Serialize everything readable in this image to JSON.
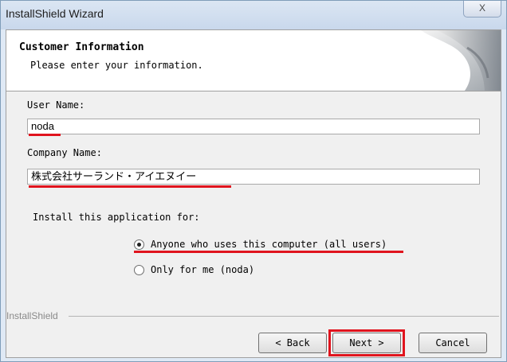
{
  "window": {
    "title": "InstallShield Wizard",
    "close_glyph": "X"
  },
  "header": {
    "title": "Customer Information",
    "subtitle": "Please enter your information."
  },
  "form": {
    "user_name_label": "User Name:",
    "user_name_value": "noda",
    "company_name_label": "Company Name:",
    "company_name_value": "株式会社サーランド・アイエヌイー",
    "install_for_label": "Install this application for:",
    "options": [
      {
        "label": "Anyone who uses this computer (all users)",
        "selected": true
      },
      {
        "label": "Only for me (noda)",
        "selected": false
      }
    ]
  },
  "footer": {
    "brand": "InstallShield",
    "back_label": "< Back",
    "next_label": "Next >",
    "cancel_label": "Cancel"
  },
  "colors": {
    "annotation_red": "#e0141e",
    "window_frame": "#dfe9f5"
  }
}
